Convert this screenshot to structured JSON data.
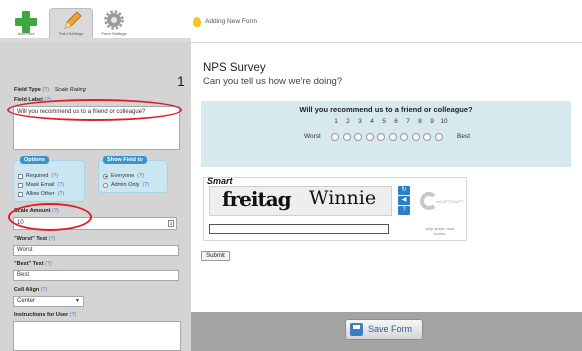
{
  "tabs": [
    {
      "label": "Add Field",
      "icon": "plus-icon"
    },
    {
      "label": "Field Settings",
      "icon": "pencil-icon"
    },
    {
      "label": "Form Settings",
      "icon": "gear-icon"
    }
  ],
  "header": {
    "title": "Adding New Form",
    "icon": "lightbulb-icon"
  },
  "left": {
    "field_type_label": "Field Type",
    "field_type_help": "(?)",
    "field_type_value": "Scale Rating",
    "field_label_label": "Field Label",
    "field_label_help": "(?)",
    "field_label_value": "Will you recommend us to a friend or colleague?",
    "options": {
      "title": "Options",
      "items": [
        {
          "label": "Required",
          "help": "(?)"
        },
        {
          "label": "Mask Email",
          "help": "(?)"
        },
        {
          "label": "Allow Other",
          "help": "(?)"
        }
      ]
    },
    "show_field": {
      "title": "Show Field to",
      "items": [
        {
          "label": "Everyone",
          "help": "(?)",
          "selected": true
        },
        {
          "label": "Admin Only",
          "help": "(?)",
          "selected": false
        }
      ]
    },
    "scale_amount_label": "Scale Amount",
    "scale_amount_help": "(?)",
    "scale_amount_value": "10",
    "worst_text_label": "\"Worst\" Text",
    "worst_text_help": "(?)",
    "worst_text_value": "Worst",
    "best_text_label": "\"Best\" Text",
    "best_text_help": "(?)",
    "best_text_value": "Best",
    "cell_align_label": "Cell Align",
    "cell_align_help": "(?)",
    "cell_align_value": "Center",
    "instructions_label": "Instructions for User",
    "instructions_help": "(?)"
  },
  "form": {
    "field_number": "1",
    "title": "NPS Survey",
    "description": "Can you tell us how we're doing?",
    "question": "Will you recommend us to a friend or colleague?",
    "scale": [
      "1",
      "2",
      "3",
      "4",
      "5",
      "6",
      "7",
      "8",
      "9",
      "10"
    ],
    "worst": "Worst",
    "best": "Best",
    "captcha": {
      "label": "Smart",
      "word1": "freitag",
      "word2": "Winnie",
      "logo_text": "reCAPTCHA™",
      "tagline": "stop spam. read books."
    },
    "submit_label": "Submit"
  },
  "footer": {
    "save_label": "Save Form"
  },
  "colors": {
    "highlight_ellipse": "#dd1f2a",
    "accent": "#3a95cc",
    "question_bg": "#d7e9ef"
  }
}
